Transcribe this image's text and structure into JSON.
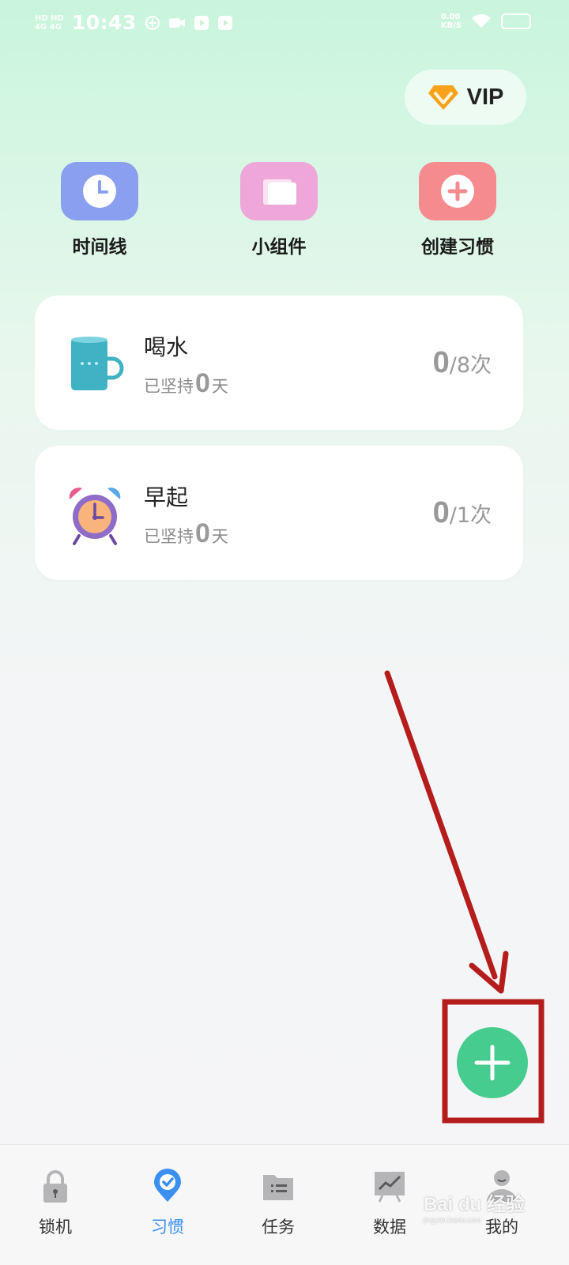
{
  "status_bar": {
    "carrier_top": "HD HD",
    "carrier_bottom": "4G 4G",
    "time": "10:43",
    "speed_top": "0.00",
    "speed_bottom": "KB/S"
  },
  "header": {
    "vip_label": "VIP"
  },
  "quick_actions": [
    {
      "label": "时间线",
      "icon": "clock-icon",
      "color": "#8a9ff0"
    },
    {
      "label": "小组件",
      "icon": "widget-icon",
      "color": "#eea7d8"
    },
    {
      "label": "创建习惯",
      "icon": "plus-icon",
      "color": "#f58a8f"
    }
  ],
  "habits": [
    {
      "title": "喝水",
      "persist_prefix": "已坚持",
      "days": "0",
      "days_suffix": "天",
      "done": "0",
      "total": "/8次",
      "icon": "cup-icon"
    },
    {
      "title": "早起",
      "persist_prefix": "已坚持",
      "days": "0",
      "days_suffix": "天",
      "done": "0",
      "total": "/1次",
      "icon": "alarm-clock-icon"
    }
  ],
  "fab": {
    "icon": "plus-icon",
    "color": "#47cc8f"
  },
  "bottom_nav": [
    {
      "label": "锁机",
      "icon": "lock-icon",
      "active": false
    },
    {
      "label": "习惯",
      "icon": "habit-check-icon",
      "active": true
    },
    {
      "label": "任务",
      "icon": "task-list-icon",
      "active": false
    },
    {
      "label": "数据",
      "icon": "chart-icon",
      "active": false
    },
    {
      "label": "我的",
      "icon": "profile-icon",
      "active": false
    }
  ],
  "watermark": {
    "main": "Bai du 经验",
    "sub": "jingyan.baidu.com"
  },
  "colors": {
    "accent": "#3a8ff0",
    "annotation": "#b51c1c"
  }
}
